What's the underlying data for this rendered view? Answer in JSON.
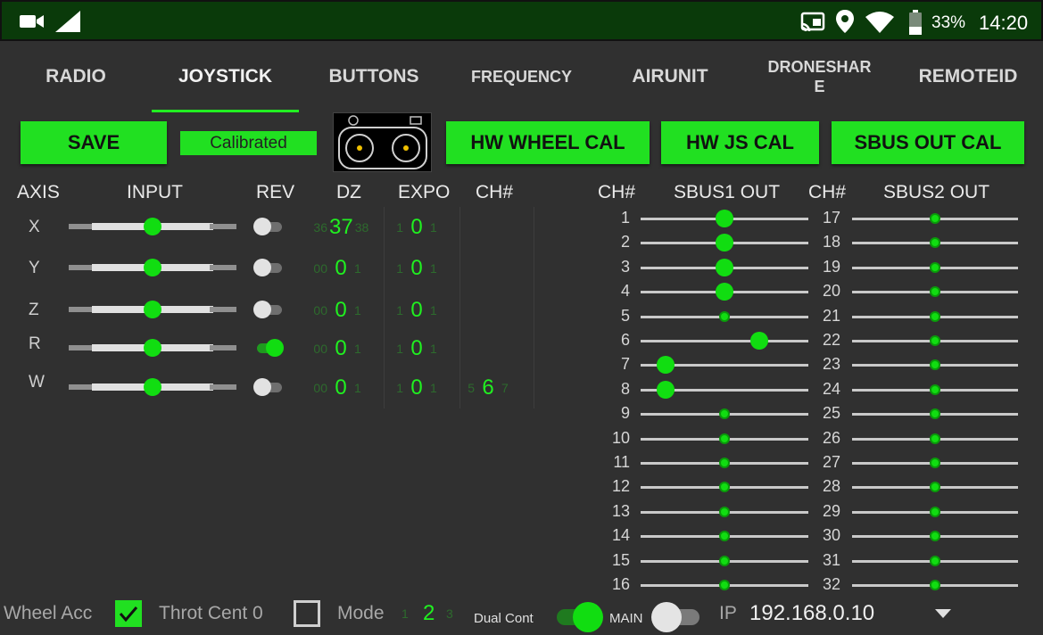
{
  "status": {
    "battery": "33%",
    "time": "14:20"
  },
  "tabs": [
    {
      "label": "RADIO"
    },
    {
      "label": "JOYSTICK"
    },
    {
      "label": "BUTTONS"
    },
    {
      "label": "FREQUENCY"
    },
    {
      "label": "AIRUNIT"
    },
    {
      "label": "DRONESHAR\nE"
    },
    {
      "label": "REMOTEID"
    }
  ],
  "active_tab": "JOYSTICK",
  "toolbar": {
    "save_label": "SAVE",
    "calibrated_label": "Calibrated",
    "hw_wheel_cal_label": "HW WHEEL CAL",
    "hw_js_cal_label": "HW JS CAL",
    "sbus_out_cal_label": "SBUS OUT CAL"
  },
  "headers": {
    "axis": "AXIS",
    "input": "INPUT",
    "rev": "REV",
    "dz": "DZ",
    "expo": "EXPO",
    "ch": "CH#",
    "ch_left": "CH#",
    "sbus1": "SBUS1 OUT",
    "ch_right": "CH#",
    "sbus2": "SBUS2 OUT"
  },
  "axes": [
    {
      "label": "X",
      "input": 0.5,
      "rev": false,
      "dz_prev": "36",
      "dz": "37",
      "dz_next": "38",
      "expo_prev": "1",
      "expo": "0",
      "expo_next": "1",
      "ch_prev": "",
      "ch": "",
      "ch_next": ""
    },
    {
      "label": "Y",
      "input": 0.5,
      "rev": false,
      "dz_prev": "00",
      "dz": "0",
      "dz_next": "1",
      "expo_prev": "1",
      "expo": "0",
      "expo_next": "1",
      "ch_prev": "",
      "ch": "",
      "ch_next": ""
    },
    {
      "label": "Z",
      "input": 0.5,
      "rev": false,
      "dz_prev": "00",
      "dz": "0",
      "dz_next": "1",
      "expo_prev": "1",
      "expo": "0",
      "expo_next": "1",
      "ch_prev": "",
      "ch": "",
      "ch_next": ""
    },
    {
      "label": "R",
      "input": 0.5,
      "rev": true,
      "dz_prev": "00",
      "dz": "0",
      "dz_next": "1",
      "expo_prev": "1",
      "expo": "0",
      "expo_next": "1",
      "ch_prev": "",
      "ch": "",
      "ch_next": ""
    },
    {
      "label": "W",
      "input": 0.5,
      "rev": false,
      "dz_prev": "00",
      "dz": "0",
      "dz_next": "1",
      "expo_prev": "1",
      "expo": "0",
      "expo_next": "1",
      "ch_prev": "5",
      "ch": "6",
      "ch_next": "7"
    }
  ],
  "sbus1": [
    {
      "ch": "1",
      "value": 0.5,
      "active": true
    },
    {
      "ch": "2",
      "value": 0.5,
      "active": true
    },
    {
      "ch": "3",
      "value": 0.5,
      "active": true
    },
    {
      "ch": "4",
      "value": 0.5,
      "active": true
    },
    {
      "ch": "5",
      "value": 0.5,
      "active": false
    },
    {
      "ch": "6",
      "value": 0.71,
      "active": true
    },
    {
      "ch": "7",
      "value": 0.15,
      "active": true
    },
    {
      "ch": "8",
      "value": 0.15,
      "active": true
    },
    {
      "ch": "9",
      "value": 0.5,
      "active": false
    },
    {
      "ch": "10",
      "value": 0.5,
      "active": false
    },
    {
      "ch": "11",
      "value": 0.5,
      "active": false
    },
    {
      "ch": "12",
      "value": 0.5,
      "active": false
    },
    {
      "ch": "13",
      "value": 0.5,
      "active": false
    },
    {
      "ch": "14",
      "value": 0.5,
      "active": false
    },
    {
      "ch": "15",
      "value": 0.5,
      "active": false
    },
    {
      "ch": "16",
      "value": 0.5,
      "active": false
    }
  ],
  "sbus2": [
    {
      "ch": "17",
      "value": 0.5,
      "active": false
    },
    {
      "ch": "18",
      "value": 0.5,
      "active": false
    },
    {
      "ch": "19",
      "value": 0.5,
      "active": false
    },
    {
      "ch": "20",
      "value": 0.5,
      "active": false
    },
    {
      "ch": "21",
      "value": 0.5,
      "active": false
    },
    {
      "ch": "22",
      "value": 0.5,
      "active": false
    },
    {
      "ch": "23",
      "value": 0.5,
      "active": false
    },
    {
      "ch": "24",
      "value": 0.5,
      "active": false
    },
    {
      "ch": "25",
      "value": 0.5,
      "active": false
    },
    {
      "ch": "26",
      "value": 0.5,
      "active": false
    },
    {
      "ch": "27",
      "value": 0.5,
      "active": false
    },
    {
      "ch": "28",
      "value": 0.5,
      "active": false
    },
    {
      "ch": "29",
      "value": 0.5,
      "active": false
    },
    {
      "ch": "30",
      "value": 0.5,
      "active": false
    },
    {
      "ch": "31",
      "value": 0.5,
      "active": false
    },
    {
      "ch": "32",
      "value": 0.5,
      "active": false
    }
  ],
  "bottom": {
    "wheel_acc_label": "Wheel Acc",
    "wheel_acc_checked": true,
    "throt_cent_label": "Throt Cent 0",
    "throt_cent_checked": false,
    "mode_label": "Mode",
    "mode_prev": "1",
    "mode_value": "2",
    "mode_next": "3",
    "dual_cont_label": "Dual Cont",
    "dual_cont_on": true,
    "main_label": "MAIN",
    "main_on": false,
    "ip_label": "IP",
    "ip_value": "192.168.0.10"
  },
  "colors": {
    "accent": "#21e021",
    "status_bar": "#0a3a0a",
    "background": "#303030"
  },
  "icons": [
    "video-camera-icon",
    "signal-icon",
    "cast-icon",
    "location-pin-icon",
    "wifi-icon",
    "battery-icon",
    "dropdown-arrow-icon"
  ]
}
